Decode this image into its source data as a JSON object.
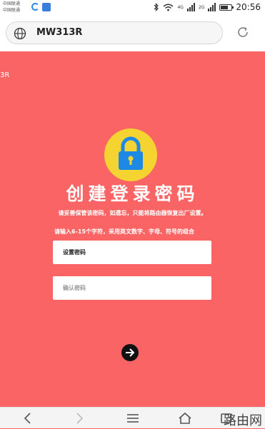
{
  "status_bar": {
    "carrier_line1": "中国联通",
    "carrier_line2": "中国联通",
    "net1": "4G",
    "net2": "2G",
    "time": "20:56",
    "battery_level": 0.75,
    "icons": [
      "browser-ring-icon",
      "app-square-icon",
      "bluetooth-icon",
      "wifi-icon",
      "signal-icon",
      "battery-icon"
    ]
  },
  "address_bar": {
    "url": "MW313R",
    "globe_icon": "globe-icon",
    "reload_icon": "reload-icon"
  },
  "page": {
    "corner_text": "3R",
    "title": "创建登录密码",
    "notice": "请妥善保管该密码，如遗忘，只能将路由器恢复出厂设置。",
    "rule": "请输入6-15个字符，采用英文数字、字母、符号的组合",
    "password_placeholder": "设置密码",
    "confirm_placeholder": "确认密码",
    "next_icon": "arrow-right-icon"
  },
  "colors": {
    "background": "#fb6464",
    "badge": "#f5d330",
    "lock": "#1e88e5"
  },
  "nav_bar": {
    "items": [
      "back-icon",
      "forward-icon",
      "menu-icon",
      "home-icon",
      "tabs-icon"
    ],
    "watermark": "路由网"
  }
}
